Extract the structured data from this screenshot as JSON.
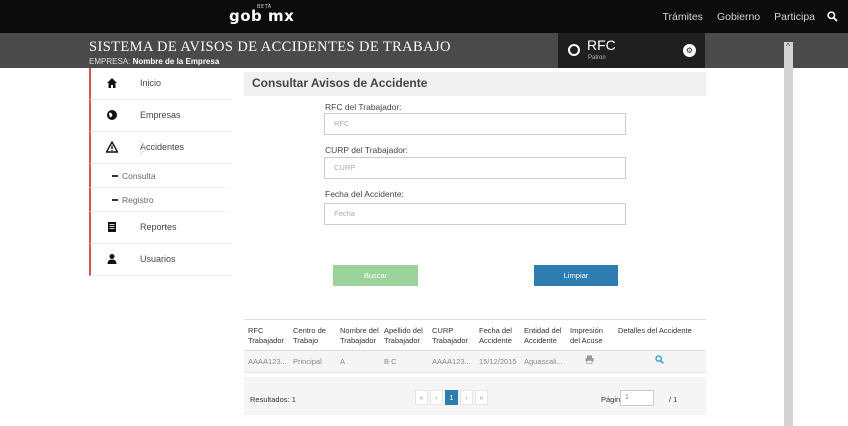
{
  "topbar": {
    "logo": "gob mx",
    "logo_badge": "BETA",
    "nav": [
      "Trámites",
      "Gobierno",
      "Participa"
    ]
  },
  "header": {
    "title": "SISTEMA DE AVISOS DE ACCIDENTES DE TRABAJO",
    "empresa_label": "EMPRESA:",
    "empresa_value": "Nombre de la Empresa",
    "rfc_label": "RFC",
    "rfc_sub": "Patron"
  },
  "sidebar": {
    "items": [
      {
        "label": "Inicio",
        "icon": "home-icon"
      },
      {
        "label": "Empresas",
        "icon": "globe-icon"
      },
      {
        "label": "Accidentes",
        "icon": "warning-icon"
      },
      {
        "label": "Reportes",
        "icon": "report-icon"
      },
      {
        "label": "Usuarios",
        "icon": "user-icon"
      }
    ],
    "subitems": [
      "Consulta",
      "Registro"
    ]
  },
  "main": {
    "title": "Consultar Avisos de Accidente",
    "fields": [
      {
        "label": "RFC del Trabajador:",
        "placeholder": "RFC"
      },
      {
        "label": "CURP del Trabajador:",
        "placeholder": "CURP"
      },
      {
        "label": "Fecha del Accidente:",
        "placeholder": "Fecha"
      }
    ],
    "buscar_label": "Buscar",
    "limpiar_label": "Limpiar"
  },
  "table": {
    "headers": [
      [
        "RFC",
        "Trabajador"
      ],
      [
        "Centro de",
        "Trabajo"
      ],
      [
        "Nombre del",
        "Trabajador"
      ],
      [
        "Apellido del",
        "Trabajador"
      ],
      [
        "CURP",
        "Trabajador"
      ],
      [
        "Fecha del",
        "Accidente"
      ],
      [
        "Entidad del",
        "Accidente"
      ],
      [
        "Impresión",
        "del Acuse"
      ],
      [
        "Detalles del Accidente",
        ""
      ]
    ],
    "rows": [
      [
        "AAAA123...",
        "Principal",
        "A",
        "B C",
        "AAAA123...",
        "15/12/2015",
        "Aguascali..."
      ]
    ],
    "results_label": "Resultados: 1",
    "pager": [
      "«",
      "‹",
      "1",
      "›",
      "»"
    ],
    "page_label": "Página:",
    "page_value": "1",
    "page_total": "/ 1"
  },
  "colors": {
    "topbar": "#0c0c0c",
    "header": "#4a4a4a",
    "accent_red": "#d9534f",
    "buscar": "#9bd39b",
    "limpiar": "#2d7db0"
  }
}
